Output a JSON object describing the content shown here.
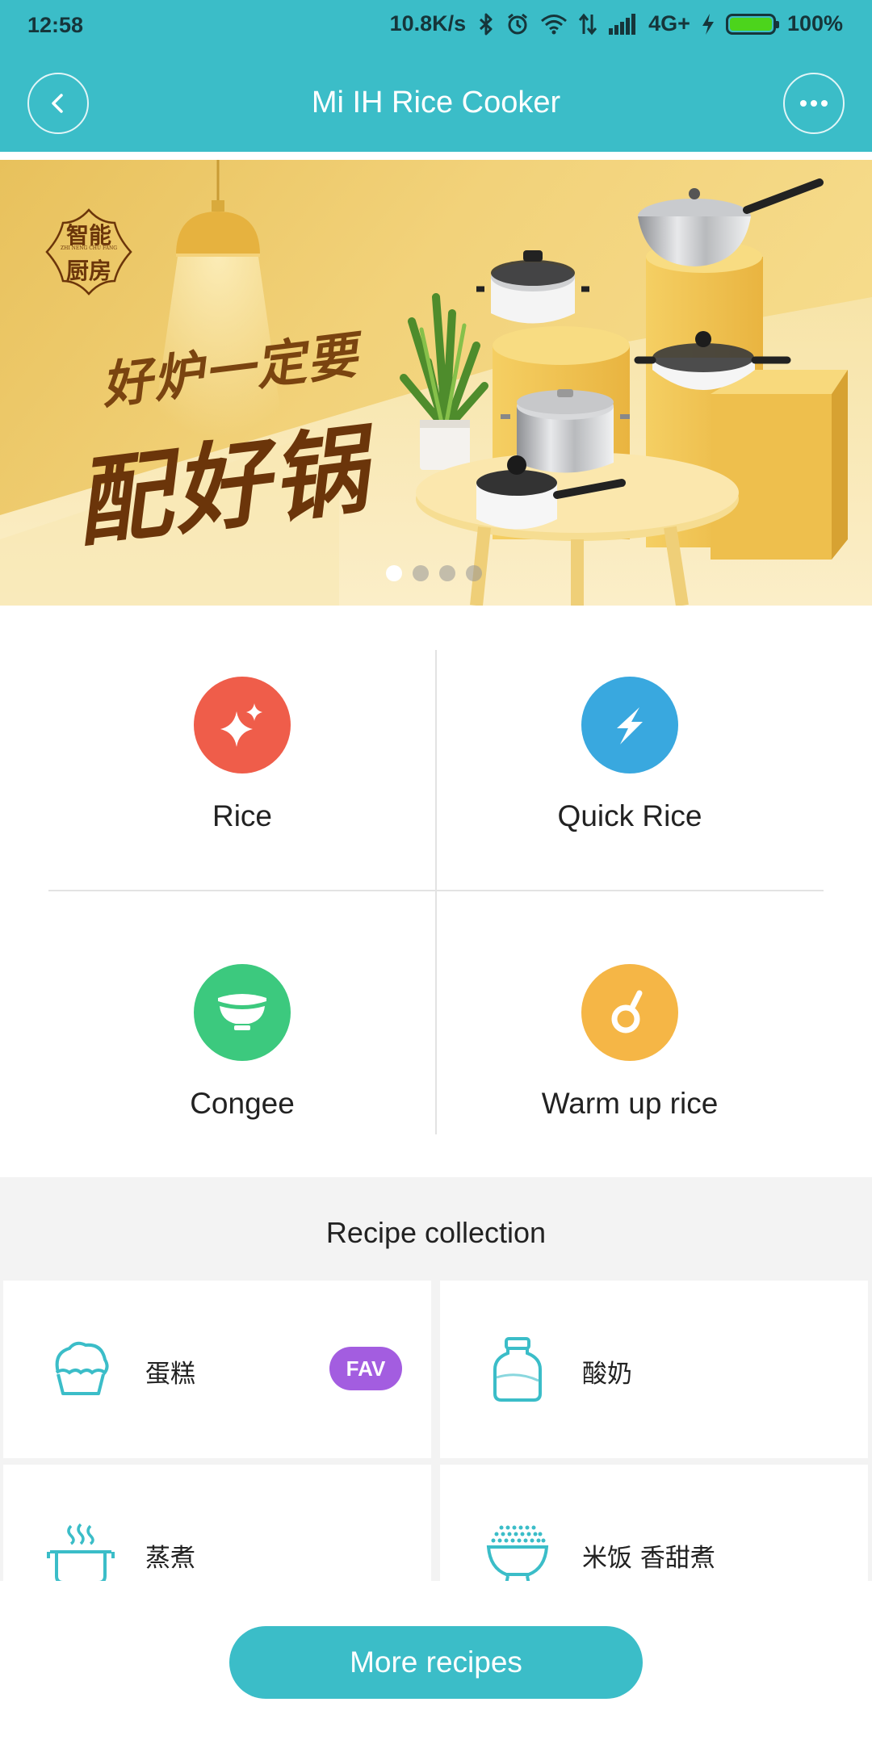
{
  "status_bar": {
    "time": "12:58",
    "network_speed": "10.8K/s",
    "network_type": "4G+",
    "battery": "100%",
    "battery_level": 1.0,
    "icons": [
      "bluetooth-icon",
      "alarm-icon",
      "wifi-icon",
      "data-arrows-icon",
      "signal-icon",
      "charging-icon",
      "battery-icon"
    ]
  },
  "header": {
    "title": "Mi IH Rice Cooker",
    "back_icon": "back-chevron-icon",
    "menu_icon": "more-dots-icon",
    "color": "#3bbdc8"
  },
  "banner": {
    "logo_top": "智能",
    "logo_sub": "ZHI NENG CHU FANG",
    "logo_bottom": "厨房",
    "line1": "好炉一定要",
    "line2": "配好锅",
    "pages": 4,
    "active_page": 1
  },
  "modes": [
    {
      "label": "Rice",
      "icon": "sparkle-icon",
      "color": "#ef5d4a"
    },
    {
      "label": "Quick Rice",
      "icon": "lightning-icon",
      "color": "#39a8df"
    },
    {
      "label": "Congee",
      "icon": "bowl-icon",
      "color": "#3cc97e"
    },
    {
      "label": "Warm up rice",
      "icon": "ladle-icon",
      "color": "#f5b646"
    }
  ],
  "recipes": {
    "title": "Recipe collection",
    "items": [
      {
        "name": "蛋糕",
        "icon": "cake-icon",
        "badge": "FAV"
      },
      {
        "name": "酸奶",
        "icon": "yogurt-jar-icon"
      },
      {
        "name": "蒸煮",
        "icon": "steam-pot-icon"
      },
      {
        "name": "米饭 香甜煮",
        "icon": "rice-bowl-icon"
      }
    ],
    "icon_color": "#3bbdc8",
    "badge_color": "#a35de0"
  },
  "bottom": {
    "more_label": "More recipes"
  }
}
